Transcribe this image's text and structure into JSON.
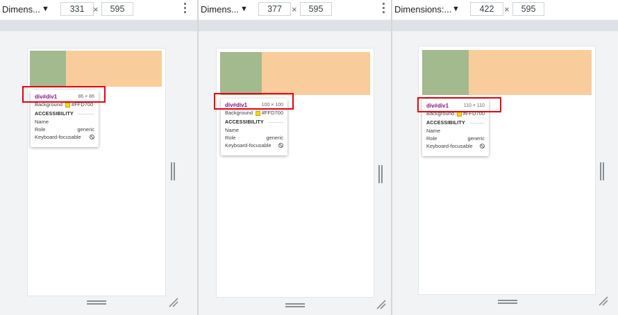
{
  "panels": [
    {
      "dimensions_label": "Dimens...",
      "width_value": "331",
      "height_value": "595",
      "times": "×",
      "tooltip": {
        "title": "div#div1",
        "size": "86 × 86",
        "background_label": "Background",
        "background_value": "#FFD700",
        "section": "ACCESSIBILITY",
        "name_label": "Name",
        "role_label": "Role",
        "role_value": "generic",
        "focus_label": "Keyboard-focusable"
      }
    },
    {
      "dimensions_label": "Dimens...",
      "width_value": "377",
      "height_value": "595",
      "times": "×",
      "tooltip": {
        "title": "div#div1",
        "size": "100 × 100",
        "background_label": "Background",
        "background_value": "#FFD700",
        "section": "ACCESSIBILITY",
        "name_label": "Name",
        "role_label": "Role",
        "role_value": "generic",
        "focus_label": "Keyboard-focusable"
      }
    },
    {
      "dimensions_label": "Dimensions:...",
      "width_value": "422",
      "height_value": "595",
      "times": "×",
      "tooltip": {
        "title": "div#div1",
        "size": "110 × 110",
        "background_label": "Background",
        "background_value": "#FFD700",
        "section": "ACCESSIBILITY",
        "name_label": "Name",
        "role_label": "Role",
        "role_value": "generic",
        "focus_label": "Keyboard-focusable"
      }
    }
  ],
  "colors": {
    "highlight_green": "#a3b98e",
    "highlight_orange": "#f8cd9b",
    "annotation_red": "#e8000e",
    "swatch_gold": "#ffd700"
  },
  "icons": {
    "dropdown": "caret-down-icon",
    "menu": "more-vert-icon",
    "not_focusable": "no-entry-icon",
    "resize": "resize-corner-icon"
  }
}
